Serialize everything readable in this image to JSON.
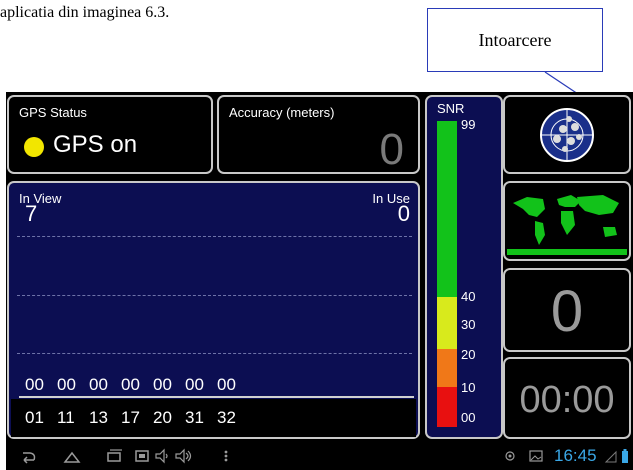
{
  "caption": "aplicatia din imaginea 6.3.",
  "callout": {
    "label": "Intoarcere"
  },
  "gps_status": {
    "label": "GPS Status",
    "value": "GPS on",
    "indicator_color": "#f2e600"
  },
  "accuracy": {
    "label": "Accuracy (meters)",
    "value": "0"
  },
  "satellites": {
    "in_view_label": "In View",
    "in_view": "7",
    "in_use_label": "In Use",
    "in_use": "0",
    "snr_values": [
      "00",
      "00",
      "00",
      "00",
      "00",
      "00",
      "00"
    ],
    "prn": [
      "01",
      "11",
      "13",
      "17",
      "20",
      "31",
      "32"
    ]
  },
  "snr_scale": {
    "label": "SNR",
    "ticks": [
      "99",
      "40",
      "30",
      "20",
      "10",
      "00"
    ],
    "colors": {
      "green": "#12c21a",
      "yellow": "#d8ea1c",
      "orange": "#f07818",
      "red": "#e81010"
    }
  },
  "speed": {
    "value": "0"
  },
  "time": {
    "value": "00:00"
  },
  "navbar": {
    "clock": "16:45",
    "clock_color": "#3aa7e6"
  },
  "icons": {
    "radar": "radar-icon",
    "map": "world-map-icon",
    "back": "back-icon",
    "home": "home-icon",
    "recent": "recent-apps-icon",
    "screenshot": "screenshot-icon",
    "volume_down": "volume-down-icon",
    "volume_up": "volume-up-icon",
    "menu": "menu-icon",
    "gps": "gps-status-icon",
    "image": "image-notification-icon",
    "signal": "signal-icon",
    "battery": "battery-icon"
  }
}
